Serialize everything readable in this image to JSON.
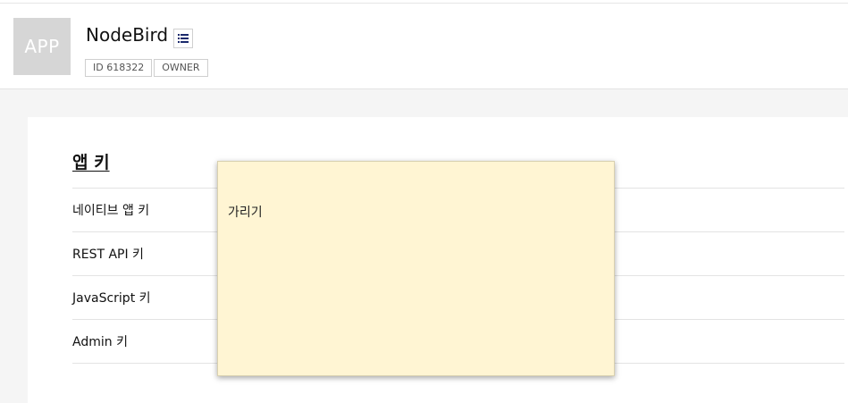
{
  "header": {
    "app_icon_text": "APP",
    "app_name": "NodeBird",
    "menu_icon": "list-icon",
    "badges": [
      "ID 618322",
      "OWNER"
    ]
  },
  "section": {
    "title": "앱 키",
    "rows": [
      {
        "label": "네이티브 앱 키"
      },
      {
        "label": "REST API 키"
      },
      {
        "label": "JavaScript 키"
      },
      {
        "label": "Admin 키"
      }
    ]
  },
  "note": {
    "text": "가리기"
  },
  "colors": {
    "note_background": "#fff5d3",
    "page_background": "#f5f5f5",
    "icon_placeholder": "#d6d6d6",
    "menu_icon_color": "#1a2a6c"
  }
}
